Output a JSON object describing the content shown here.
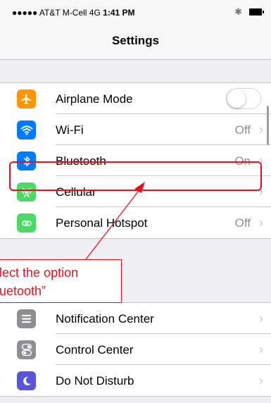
{
  "status_bar": {
    "carrier": "●●●●● AT&T M-Cell  4G",
    "time": "1:41 PM",
    "bluetooth_glyph": "✱"
  },
  "nav": {
    "title": "Settings"
  },
  "settings_group_1": [
    {
      "label": "Airplane Mode",
      "icon": "airplane-icon",
      "color": "#ff9500",
      "control": "toggle",
      "toggle_on": false
    },
    {
      "label": "Wi-Fi",
      "icon": "wifi-icon",
      "color": "#007aff",
      "value": "Off"
    },
    {
      "label": "Bluetooth",
      "icon": "bluetooth-icon",
      "color": "#007aff",
      "value": "On"
    },
    {
      "label": "Cellular",
      "icon": "cellular-icon",
      "color": "#4cd964"
    },
    {
      "label": "Personal Hotspot",
      "icon": "hotspot-icon",
      "color": "#4cd964",
      "value": "Off"
    }
  ],
  "settings_group_2": [
    {
      "label": "Notification Center",
      "icon": "notifications-icon",
      "color": "#8e8e93"
    },
    {
      "label": "Control Center",
      "icon": "control-center-icon",
      "color": "#8e8e93"
    },
    {
      "label": "Do Not Disturb",
      "icon": "moon-icon",
      "color": "#5856d6"
    }
  ],
  "chevron": "›",
  "annotation": {
    "line1": "Select the option",
    "line2": "“Bluetooth”",
    "color": "#e4111f"
  }
}
